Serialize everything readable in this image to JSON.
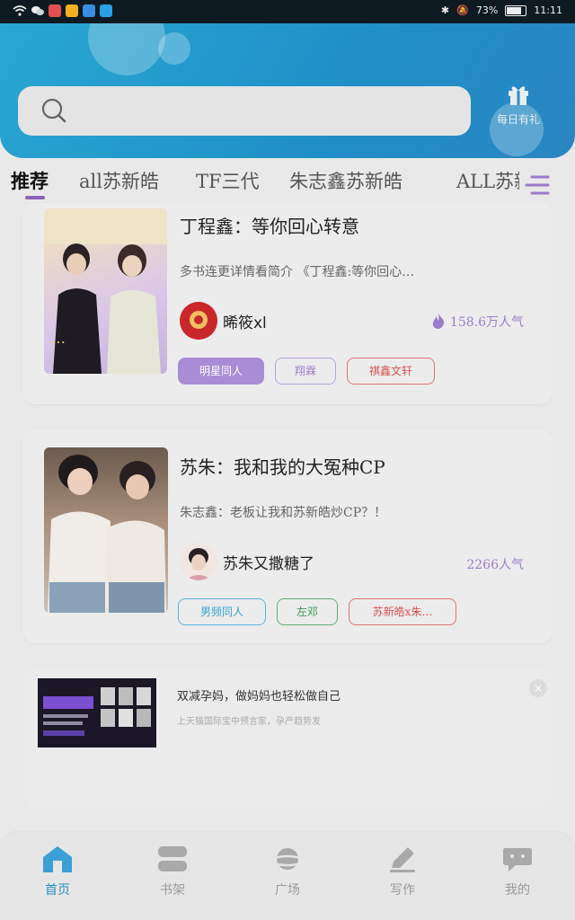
{
  "status": {
    "battery": "73%",
    "time": "11:11"
  },
  "header": {
    "search_placeholder": "",
    "gift_label": "每日有礼"
  },
  "tabs": [
    {
      "label": "推荐",
      "active": true
    },
    {
      "label": "all苏新皓",
      "active": false
    },
    {
      "label": "TF三代",
      "active": false
    },
    {
      "label": "朱志鑫苏新皓",
      "active": false
    },
    {
      "label": "ALL苏新",
      "active": false
    }
  ],
  "cards": [
    {
      "title": "丁程鑫：等你回心转意",
      "intro": "多书连更详情看简介 《丁程鑫:等你回心…",
      "author": "晞筱xl",
      "popularity": "158.6万人气",
      "tags": [
        "明星同人",
        "翔霖",
        "祺鑫文轩"
      ]
    },
    {
      "title": "苏朱：我和我的大冤种CP",
      "intro": "朱志鑫：老板让我和苏新皓炒CP？！",
      "author": "苏朱又撒糖了",
      "popularity": "2266人气",
      "tags": [
        "男频同人",
        "左邓",
        "苏新皓x朱…"
      ]
    }
  ],
  "ad": {
    "title": "双减孕妈，做妈妈也轻松做自己",
    "desc": "上天猫国际宝中预言家，孕产趋势发",
    "close": "×"
  },
  "nav": [
    {
      "label": "首页",
      "icon": "home-icon",
      "active": true
    },
    {
      "label": "书架",
      "icon": "bookshelf-icon",
      "active": false
    },
    {
      "label": "广场",
      "icon": "planet-icon",
      "active": false
    },
    {
      "label": "写作",
      "icon": "pen-icon",
      "active": false
    },
    {
      "label": "我的",
      "icon": "chat-icon",
      "active": false
    }
  ],
  "colors": {
    "accent": "#2a90c8",
    "purple": "#9b7ccc"
  }
}
